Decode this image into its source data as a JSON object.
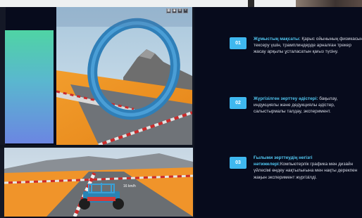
{
  "viewport": {
    "toolbar_icons": [
      "grid-icon",
      "camera-icon",
      "settings-icon",
      "close-icon"
    ]
  },
  "hud": {
    "speed": "16 km/h"
  },
  "items": [
    {
      "number": "01",
      "heading": "Жұмыстың мақсаты:",
      "body": " Қарыс ойынының физикасын тексеру үшін, трамплиндерде арналған трекер жасау арқылы ұсталасатын қағыз түсіну."
    },
    {
      "number": "02",
      "heading": "Жүргізілген зерттеу әдістері:",
      "body": " бақылау, индукциялы және дедукциялы әдістер, салыстырмалы талдау, эксперимент."
    },
    {
      "number": "03",
      "heading": " Ғылыми зерттеудің негізгі нәтижелері:",
      "body": "Компьютерлік графика мен дизайн үйлесімі өндеу нақтылығына мен нақты дерекпен жақын эксперимент жүргізілді."
    }
  ],
  "colors": {
    "accent": "#3fb8ef",
    "background": "#070b1c",
    "heading": "#52c9f3"
  }
}
